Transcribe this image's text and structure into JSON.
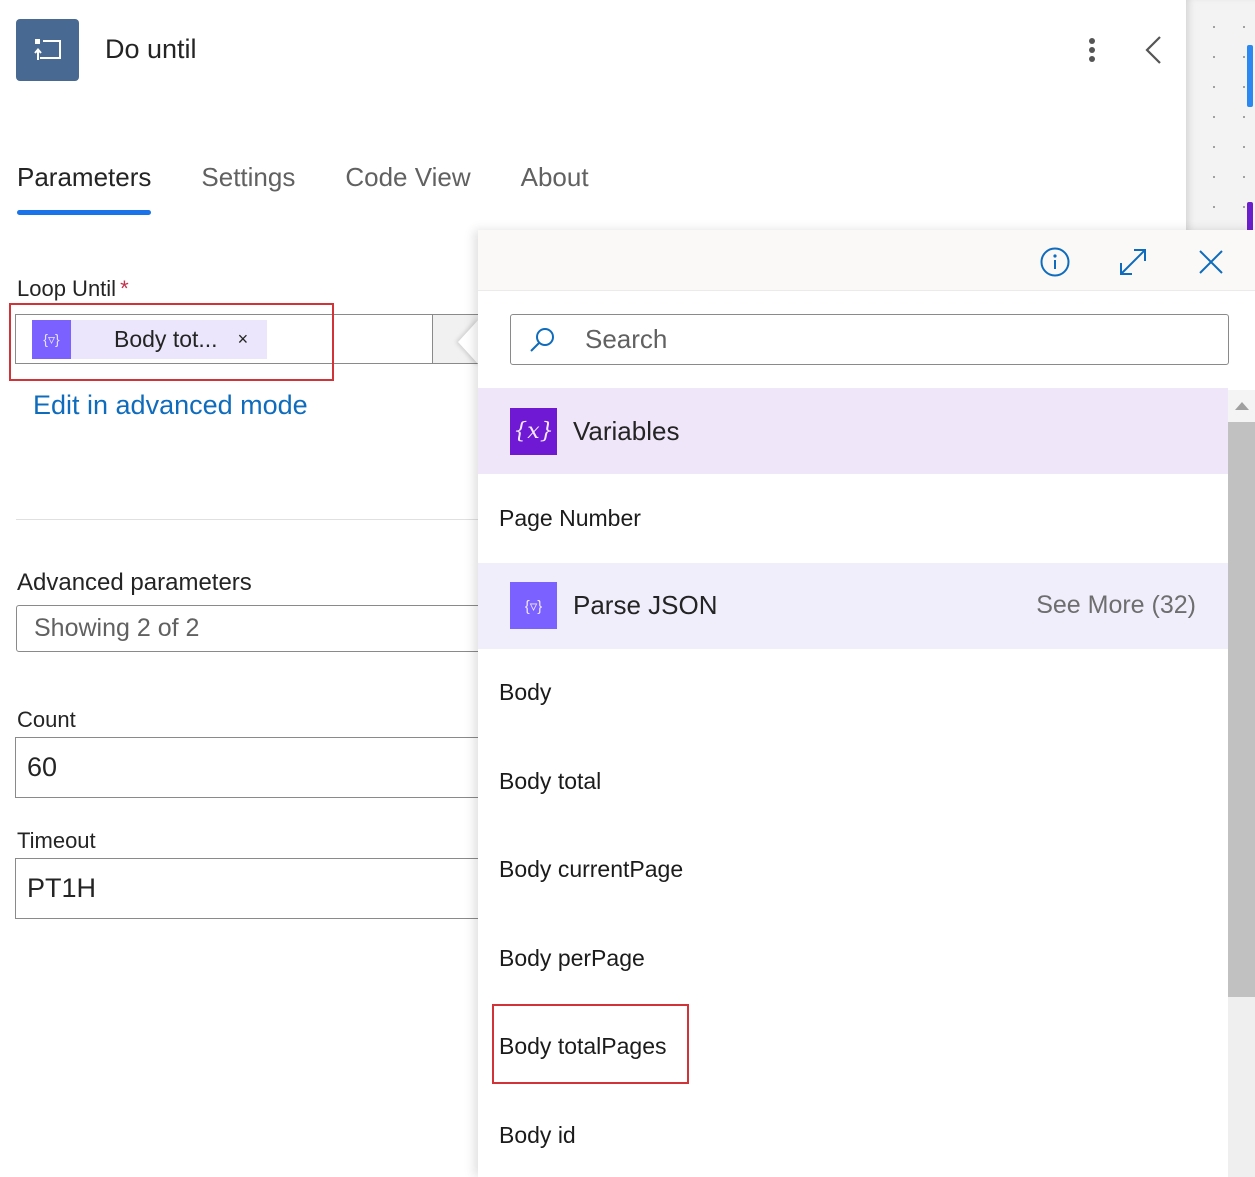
{
  "header": {
    "title": "Do until",
    "icon": "do-until-loop-icon",
    "more_icon": "more-vertical-icon",
    "collapse_icon": "chevron-left-icon"
  },
  "tabs": [
    {
      "label": "Parameters",
      "active": true
    },
    {
      "label": "Settings",
      "active": false
    },
    {
      "label": "Code View",
      "active": false
    },
    {
      "label": "About",
      "active": false
    }
  ],
  "parameters": {
    "loop_until": {
      "label": "Loop Until",
      "required_mark": "*",
      "token": {
        "icon": "parse-json-icon",
        "text": "Body tot...",
        "remove": "×"
      }
    },
    "edit_advanced_link": "Edit in advanced mode",
    "advanced": {
      "label": "Advanced parameters",
      "value": "Showing 2 of 2"
    },
    "count": {
      "label": "Count",
      "value": "60"
    },
    "timeout": {
      "label": "Timeout",
      "value": "PT1H"
    }
  },
  "picker": {
    "header_icons": [
      "info-icon",
      "expand-icon",
      "close-icon"
    ],
    "search": {
      "placeholder": "Search",
      "value": ""
    },
    "groups": [
      {
        "title": "Variables",
        "icon": "variables-icon",
        "icon_glyph": "{x}",
        "items": [
          "Page Number"
        ]
      },
      {
        "title": "Parse JSON",
        "icon": "parse-json-icon",
        "icon_glyph": "{▿}",
        "see_more": "See More (32)",
        "items": [
          "Body",
          "Body total",
          "Body currentPage",
          "Body perPage",
          "Body totalPages",
          "Body id"
        ]
      }
    ],
    "highlighted_item": "Body totalPages"
  },
  "colors": {
    "accent": "#1a73e8",
    "link": "#0f6cbd",
    "variables_icon_bg": "#7019d4",
    "parse_json_icon_bg": "#7b61ff",
    "highlight_box": "#d13438",
    "header_icon_bg": "#486991"
  }
}
